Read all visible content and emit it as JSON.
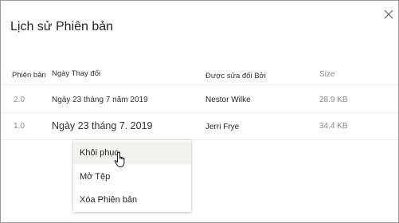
{
  "dialog": {
    "title": "Lịch sử Phiên bản",
    "close_icon": "close-icon"
  },
  "table": {
    "headers": {
      "version": "Phiên bản",
      "date": "Ngày Thay đổi",
      "editor": "Được sửa đổi Bởi",
      "size": "Size"
    },
    "rows": [
      {
        "version": "2.0",
        "date": "Ngày 23 tháng 7 năm 2019",
        "editor": "Nestor Wilke",
        "size": "28.9 KB"
      },
      {
        "version": "1.0",
        "date": "Ngày 23 tháng 7. 2019",
        "editor": "Jerri Frye",
        "size": "34.4 KB"
      }
    ]
  },
  "context_menu": {
    "items": [
      {
        "label": "Khôi phục"
      },
      {
        "label": "Mở Tệp"
      },
      {
        "label": "Xóa Phiên bản"
      }
    ],
    "hovered_item": "Khôi phục",
    "cursor_icon": "hand-pointer-icon"
  }
}
